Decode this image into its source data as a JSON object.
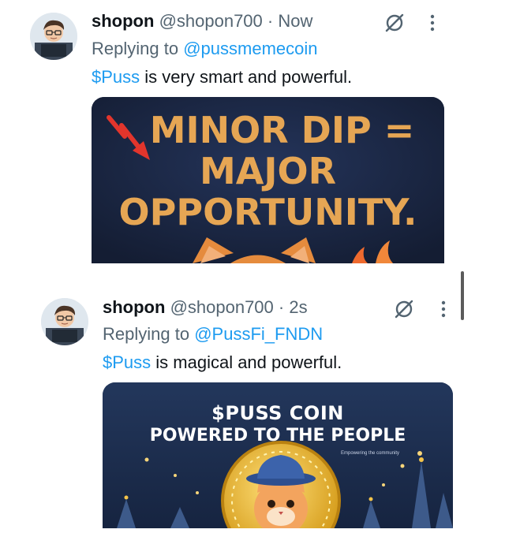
{
  "tweets": [
    {
      "name": "shopon",
      "handle": "@shopon700",
      "separator": "·",
      "time": "Now",
      "replying_prefix": "Replying to",
      "replying_to": "@pussmemecoin",
      "cashtag": "$Puss",
      "text": " is very smart and powerful.",
      "media": {
        "line1": "MINOR DIP =",
        "line2": "MAJOR",
        "line3": "OPPORTUNITY."
      }
    },
    {
      "name": "shopon",
      "handle": "@shopon700",
      "separator": "·",
      "time": "2s",
      "replying_prefix": "Replying to",
      "replying_to": "@PussFi_FNDN",
      "cashtag": "$Puss",
      "text": " is magical and powerful.",
      "media": {
        "line1": "$PUSS COIN",
        "line2": "POWERED TO THE PEOPLE",
        "small": "Empowering the community"
      }
    }
  ],
  "colors": {
    "accent": "#1d9bf0",
    "muted": "#536471",
    "media1_bg": "#1b2742",
    "media1_text": "#e6a654",
    "media2_bg": "#1c2d4d"
  }
}
